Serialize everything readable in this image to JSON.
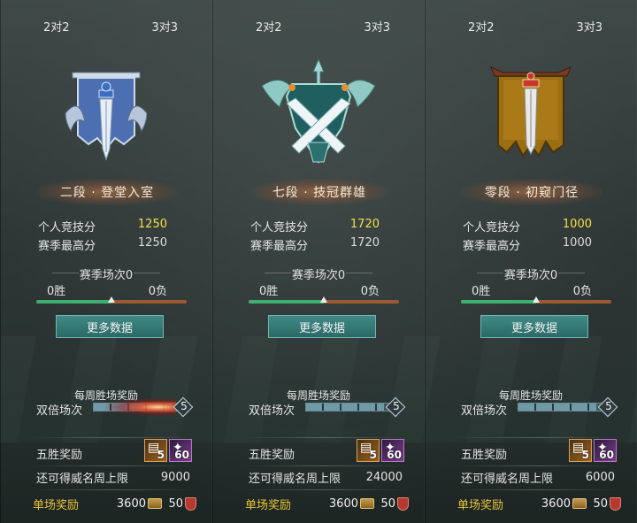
{
  "panels": [
    {
      "id": "rank-2",
      "mode_tabs": [
        "2对2",
        "3对3"
      ],
      "emblem": "blue-banner-sword-emblem",
      "rank_title": "二段 · 登堂入室",
      "personal_score_label": "个人竞技分",
      "personal_score": "1250",
      "season_high_label": "赛季最高分",
      "season_high": "1250",
      "season_games_label": "赛季场次0",
      "wins": "0胜",
      "losses": "0负",
      "win_ratio": 0.5,
      "more_data_label": "更多数据",
      "weekly_title": "每周胜场奖励",
      "double_label": "双倍场次",
      "weekly_count": "5",
      "weekly_progress": 0.9,
      "five_win_label": "五胜奖励",
      "five_win_items": [
        {
          "icon": "gold-card-icon",
          "count": "5"
        },
        {
          "icon": "purple-gem-icon",
          "count": "60"
        }
      ],
      "fame_cap_label": "还可得威名周上限",
      "fame_cap": "9000",
      "single_label": "单场奖励",
      "single_gold": "3600",
      "single_honor": "50"
    },
    {
      "id": "rank-7",
      "mode_tabs": [
        "2对2",
        "3对3"
      ],
      "emblem": "teal-crossed-swords-emblem",
      "rank_title": "七段 · 技冠群雄",
      "personal_score_label": "个人竞技分",
      "personal_score": "1720",
      "season_high_label": "赛季最高分",
      "season_high": "1720",
      "season_games_label": "赛季场次0",
      "wins": "0胜",
      "losses": "0负",
      "win_ratio": 0.5,
      "more_data_label": "更多数据",
      "weekly_title": "每周胜场奖励",
      "double_label": "双倍场次",
      "weekly_count": "5",
      "weekly_progress": 0.9,
      "five_win_label": "五胜奖励",
      "five_win_items": [
        {
          "icon": "gold-card-icon",
          "count": "5"
        },
        {
          "icon": "purple-gem-icon",
          "count": "60"
        }
      ],
      "fame_cap_label": "还可得威名周上限",
      "fame_cap": "24000",
      "single_label": "单场奖励",
      "single_gold": "3600",
      "single_honor": "50"
    },
    {
      "id": "rank-0",
      "mode_tabs": [
        "2对2",
        "3对3"
      ],
      "emblem": "brown-banner-sword-emblem",
      "rank_title": "零段 · 初窥门径",
      "personal_score_label": "个人竞技分",
      "personal_score": "1000",
      "season_high_label": "赛季最高分",
      "season_high": "1000",
      "season_games_label": "赛季场次0",
      "wins": "0胜",
      "losses": "0负",
      "win_ratio": 0.5,
      "more_data_label": "更多数据",
      "weekly_title": "每周胜场奖励",
      "double_label": "双倍场次",
      "weekly_count": "5",
      "weekly_progress": 0.9,
      "five_win_label": "五胜奖励",
      "five_win_items": [
        {
          "icon": "gold-card-icon",
          "count": "5"
        },
        {
          "icon": "purple-gem-icon",
          "count": "60"
        }
      ],
      "fame_cap_label": "还可得威名周上限",
      "fame_cap": "6000",
      "single_label": "单场奖励",
      "single_gold": "3600",
      "single_honor": "50"
    }
  ],
  "colors": {
    "highlight_score": "#f4e04a",
    "single_label": "#e8c43a",
    "win_bar": "#3fae6f",
    "loss_bar": "#9a5a34",
    "button": "#2b6965"
  }
}
